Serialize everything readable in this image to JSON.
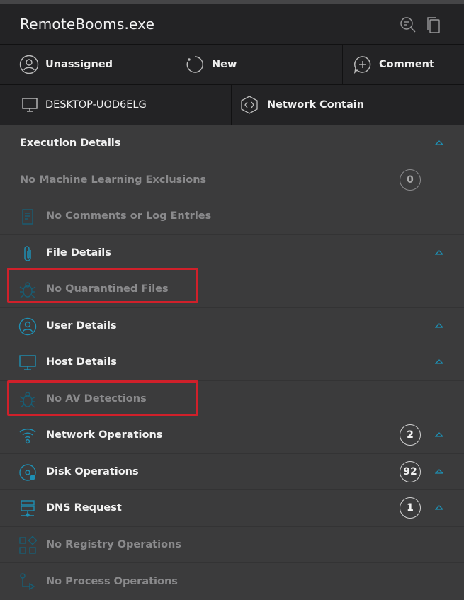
{
  "window": {
    "title": "RemoteBooms.exe"
  },
  "toolbar": {
    "assignee": "Unassigned",
    "status": "New",
    "comment": "Comment",
    "host": "DESKTOP-UOD6ELG",
    "network_contain": "Network Contain"
  },
  "sections": [
    {
      "label": "Execution Details",
      "icon": "",
      "badge": "",
      "expandable": true,
      "dim": false
    },
    {
      "label": "No Machine Learning Exclusions",
      "icon": "",
      "badge": "0",
      "expandable": false,
      "dim": true
    },
    {
      "label": "No Comments or Log Entries",
      "icon": "notes-icon",
      "badge": "",
      "expandable": false,
      "dim": true
    },
    {
      "label": "File Details",
      "icon": "paperclip-icon",
      "badge": "",
      "expandable": true,
      "dim": false
    },
    {
      "label": "No Quarantined Files",
      "icon": "bug-icon",
      "badge": "",
      "expandable": false,
      "dim": true
    },
    {
      "label": "User Details",
      "icon": "user-icon",
      "badge": "",
      "expandable": true,
      "dim": false
    },
    {
      "label": "Host Details",
      "icon": "monitor-icon",
      "badge": "",
      "expandable": true,
      "dim": false
    },
    {
      "label": "No AV Detections",
      "icon": "bug-icon",
      "badge": "",
      "expandable": false,
      "dim": true
    },
    {
      "label": "Network Operations",
      "icon": "wifi-icon",
      "badge": "2",
      "expandable": true,
      "dim": false
    },
    {
      "label": "Disk Operations",
      "icon": "disk-icon",
      "badge": "92",
      "expandable": true,
      "dim": false
    },
    {
      "label": "DNS Request",
      "icon": "server-icon",
      "badge": "1",
      "expandable": true,
      "dim": false
    },
    {
      "label": "No Registry Operations",
      "icon": "registry-icon",
      "badge": "",
      "expandable": false,
      "dim": true
    },
    {
      "label": "No Process Operations",
      "icon": "process-icon",
      "badge": "",
      "expandable": false,
      "dim": true
    }
  ],
  "colors": {
    "accent": "#1e8fb3",
    "highlight": "#d0202a",
    "panel": "#3b3b3c",
    "header": "#232325"
  }
}
